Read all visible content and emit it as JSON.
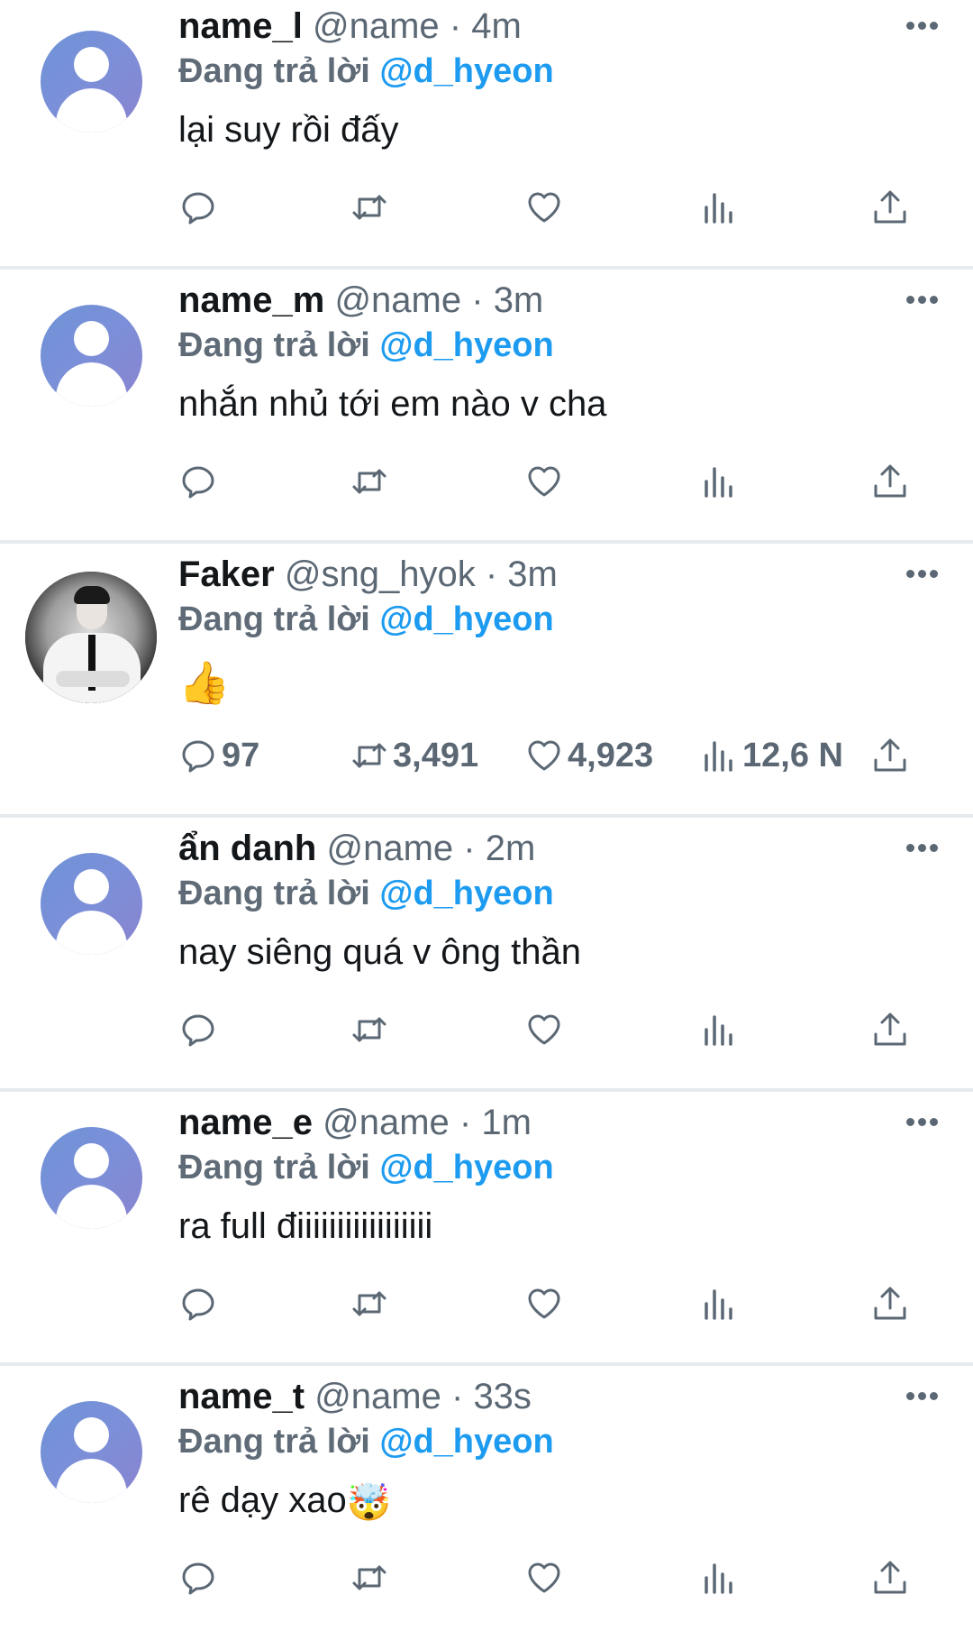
{
  "reply_prefix": "Đang trả lời",
  "icons": [
    "reply-icon",
    "retweet-icon",
    "like-icon",
    "views-icon",
    "share-icon",
    "more-icon"
  ],
  "colors": {
    "accent": "#1d9bf0",
    "muted": "#5b6874",
    "divider": "#e8ebee"
  },
  "tweets": [
    {
      "name": "name_l",
      "handle": "@name",
      "sep": "·",
      "time": "4m",
      "replying_to": "@d_hyeon",
      "text": "lại suy rồi đấy",
      "avatar": "default"
    },
    {
      "name": "name_m",
      "handle": "@name",
      "sep": "·",
      "time": "3m",
      "replying_to": "@d_hyeon",
      "text": "nhắn nhủ tới em nào v cha",
      "avatar": "default"
    },
    {
      "name": "Faker",
      "handle": "@sng_hyok",
      "sep": "·",
      "time": "3m",
      "replying_to": "@d_hyeon",
      "text": "👍",
      "avatar": "photo",
      "counts": {
        "replies": "97",
        "retweets": "3,491",
        "likes": "4,923",
        "views": "12,6 N"
      }
    },
    {
      "name": "ẩn danh",
      "handle": "@name",
      "sep": "·",
      "time": "2m",
      "replying_to": "@d_hyeon",
      "text": "nay siêng quá v ông thần",
      "avatar": "default"
    },
    {
      "name": "name_e",
      "handle": "@name",
      "sep": "·",
      "time": "1m",
      "replying_to": "@d_hyeon",
      "text": "ra full điiiiiiiiiiiiiiiii",
      "avatar": "default"
    },
    {
      "name": "name_t",
      "handle": "@name",
      "sep": "·",
      "time": "33s",
      "replying_to": "@d_hyeon",
      "text": "rê dạy xao",
      "text_emoji": "🤯",
      "avatar": "default"
    }
  ]
}
